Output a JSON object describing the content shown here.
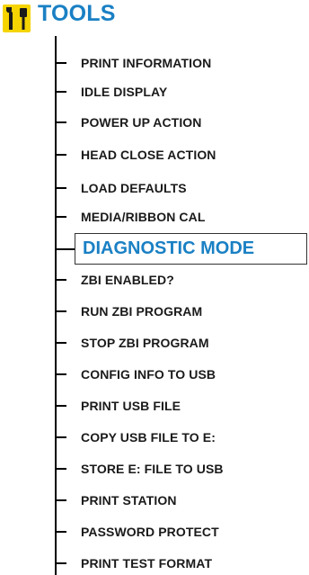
{
  "menu": {
    "title": "TOOLS",
    "icon": "tools-icon",
    "accent_color": "#1a80c4",
    "items": [
      {
        "label": "PRINT INFORMATION"
      },
      {
        "label": "IDLE DISPLAY"
      },
      {
        "label": "POWER UP ACTION"
      },
      {
        "label": "HEAD CLOSE ACTION"
      },
      {
        "label": "LOAD DEFAULTS"
      },
      {
        "label": "MEDIA/RIBBON CAL"
      },
      {
        "label": "DIAGNOSTIC MODE",
        "selected": true
      },
      {
        "label": "ZBI ENABLED?"
      },
      {
        "label": "RUN ZBI PROGRAM"
      },
      {
        "label": "STOP ZBI PROGRAM"
      },
      {
        "label": "CONFIG INFO TO USB"
      },
      {
        "label": "PRINT USB FILE"
      },
      {
        "label": "COPY USB FILE TO E:"
      },
      {
        "label": "STORE E: FILE TO USB"
      },
      {
        "label": "PRINT STATION"
      },
      {
        "label": "PASSWORD PROTECT"
      },
      {
        "label": "PRINT TEST FORMAT"
      }
    ]
  }
}
